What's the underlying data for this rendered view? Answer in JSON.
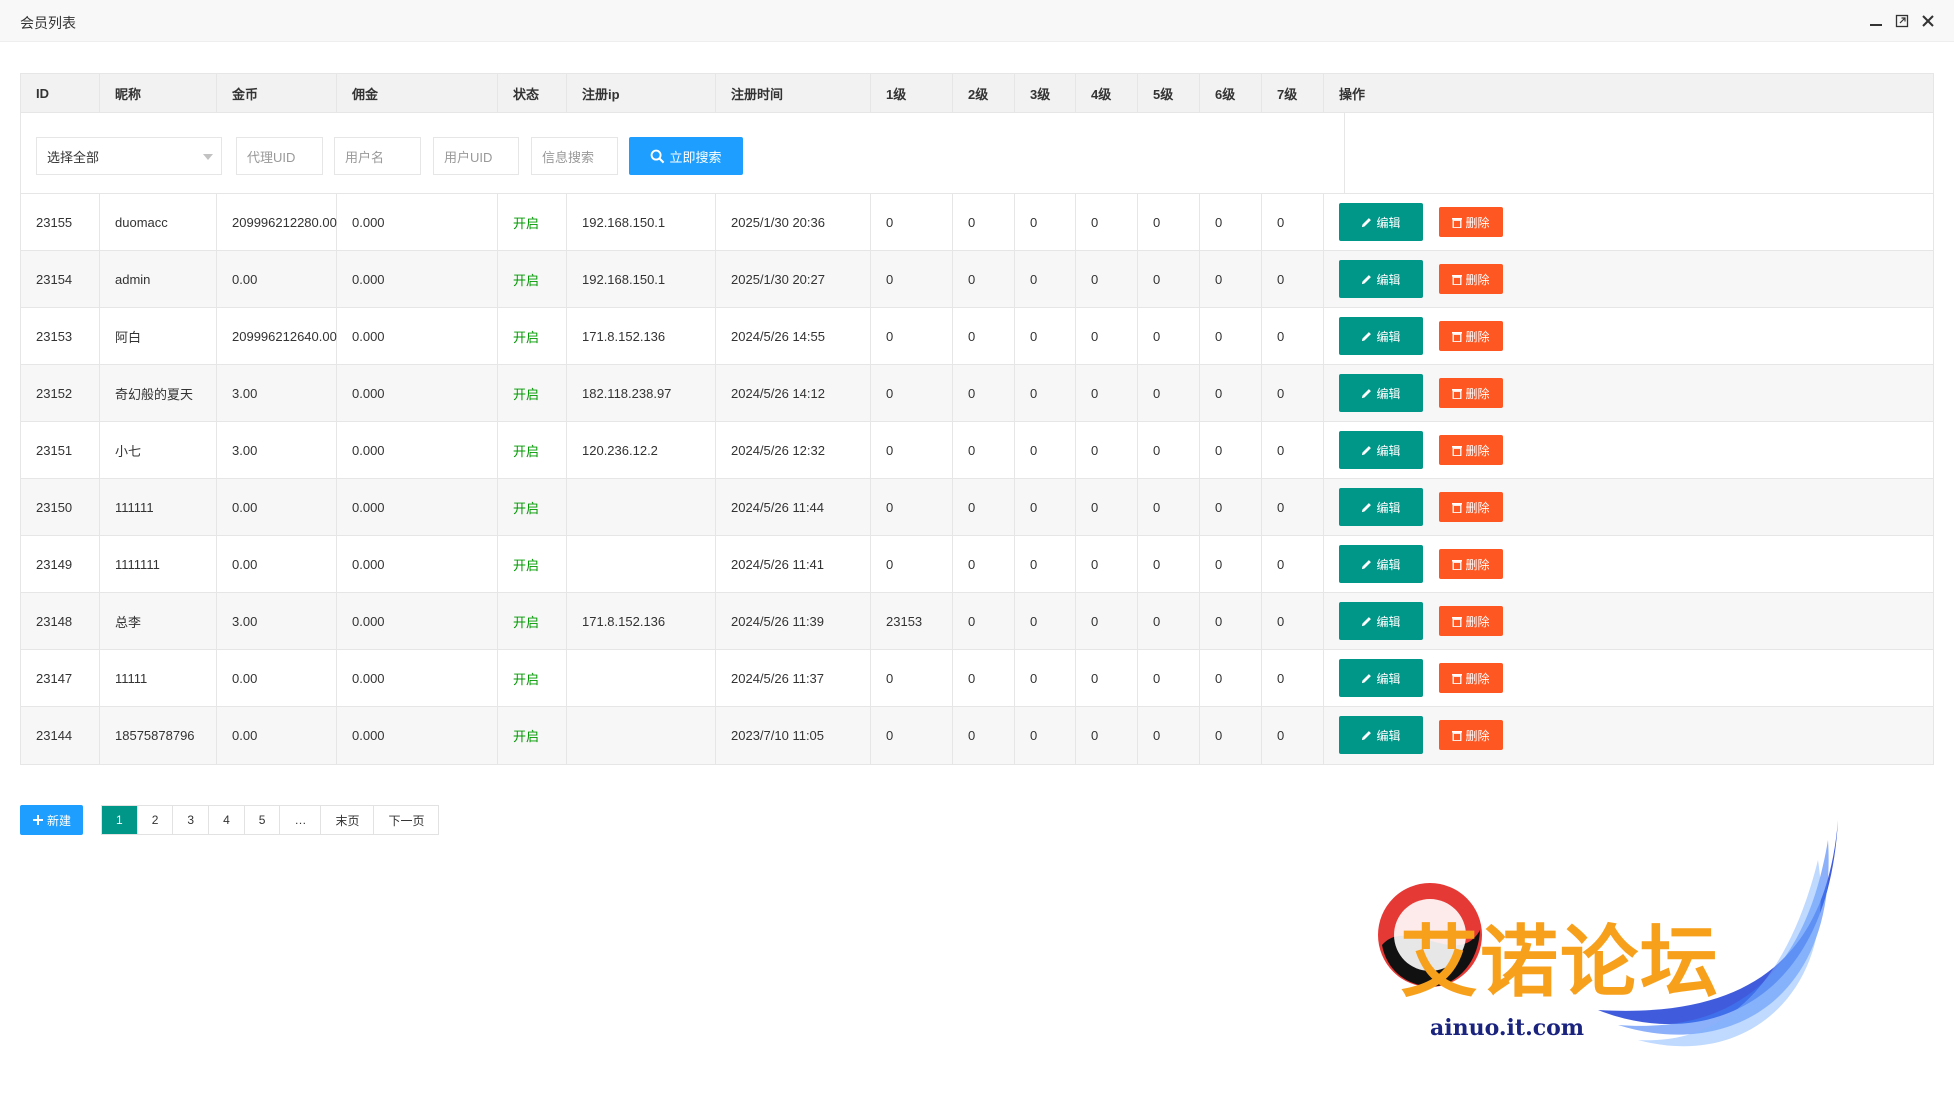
{
  "window": {
    "title": "会员列表"
  },
  "columns": [
    "ID",
    "昵称",
    "金币",
    "佣金",
    "状态",
    "注册ip",
    "注册时间",
    "1级",
    "2级",
    "3级",
    "4级",
    "5级",
    "6级",
    "7级",
    "操作"
  ],
  "filters": {
    "select_value": "选择全部",
    "agent_uid_placeholder": "代理UID",
    "username_placeholder": "用户名",
    "user_uid_placeholder": "用户UID",
    "info_search_placeholder": "信息搜索",
    "search_button": "立即搜索"
  },
  "rows": [
    {
      "id": "23155",
      "nickname": "duomacc",
      "coins": "209996212280.00",
      "commission": "0.000",
      "status": "开启",
      "reg_ip": "192.168.150.1",
      "reg_time": "2025/1/30 20:36",
      "l1": "0",
      "l2": "0",
      "l3": "0",
      "l4": "0",
      "l5": "0",
      "l6": "0",
      "l7": "0"
    },
    {
      "id": "23154",
      "nickname": "admin",
      "coins": "0.00",
      "commission": "0.000",
      "status": "开启",
      "reg_ip": "192.168.150.1",
      "reg_time": "2025/1/30 20:27",
      "l1": "0",
      "l2": "0",
      "l3": "0",
      "l4": "0",
      "l5": "0",
      "l6": "0",
      "l7": "0"
    },
    {
      "id": "23153",
      "nickname": "阿白",
      "coins": "209996212640.00",
      "commission": "0.000",
      "status": "开启",
      "reg_ip": "171.8.152.136",
      "reg_time": "2024/5/26 14:55",
      "l1": "0",
      "l2": "0",
      "l3": "0",
      "l4": "0",
      "l5": "0",
      "l6": "0",
      "l7": "0"
    },
    {
      "id": "23152",
      "nickname": "奇幻般的夏天",
      "coins": "3.00",
      "commission": "0.000",
      "status": "开启",
      "reg_ip": "182.118.238.97",
      "reg_time": "2024/5/26 14:12",
      "l1": "0",
      "l2": "0",
      "l3": "0",
      "l4": "0",
      "l5": "0",
      "l6": "0",
      "l7": "0"
    },
    {
      "id": "23151",
      "nickname": "小七",
      "coins": "3.00",
      "commission": "0.000",
      "status": "开启",
      "reg_ip": "120.236.12.2",
      "reg_time": "2024/5/26 12:32",
      "l1": "0",
      "l2": "0",
      "l3": "0",
      "l4": "0",
      "l5": "0",
      "l6": "0",
      "l7": "0"
    },
    {
      "id": "23150",
      "nickname": "111111",
      "coins": "0.00",
      "commission": "0.000",
      "status": "开启",
      "reg_ip": "",
      "reg_time": "2024/5/26 11:44",
      "l1": "0",
      "l2": "0",
      "l3": "0",
      "l4": "0",
      "l5": "0",
      "l6": "0",
      "l7": "0"
    },
    {
      "id": "23149",
      "nickname": "1111111",
      "coins": "0.00",
      "commission": "0.000",
      "status": "开启",
      "reg_ip": "",
      "reg_time": "2024/5/26 11:41",
      "l1": "0",
      "l2": "0",
      "l3": "0",
      "l4": "0",
      "l5": "0",
      "l6": "0",
      "l7": "0"
    },
    {
      "id": "23148",
      "nickname": "总李",
      "coins": "3.00",
      "commission": "0.000",
      "status": "开启",
      "reg_ip": "171.8.152.136",
      "reg_time": "2024/5/26 11:39",
      "l1": "23153",
      "l2": "0",
      "l3": "0",
      "l4": "0",
      "l5": "0",
      "l6": "0",
      "l7": "0"
    },
    {
      "id": "23147",
      "nickname": "11111",
      "coins": "0.00",
      "commission": "0.000",
      "status": "开启",
      "reg_ip": "",
      "reg_time": "2024/5/26 11:37",
      "l1": "0",
      "l2": "0",
      "l3": "0",
      "l4": "0",
      "l5": "0",
      "l6": "0",
      "l7": "0"
    },
    {
      "id": "23144",
      "nickname": "18575878796",
      "coins": "0.00",
      "commission": "0.000",
      "status": "开启",
      "reg_ip": "",
      "reg_time": "2023/7/10 11:05",
      "l1": "0",
      "l2": "0",
      "l3": "0",
      "l4": "0",
      "l5": "0",
      "l6": "0",
      "l7": "0"
    }
  ],
  "actions": {
    "edit": "编辑",
    "delete": "删除"
  },
  "footer": {
    "new_button": "新建",
    "pages": [
      "1",
      "2",
      "3",
      "4",
      "5",
      "…",
      "末页",
      "下一页"
    ],
    "current_page": "1"
  },
  "watermark": {
    "text": "艾诺论坛",
    "domain": "ainuo.it.com"
  },
  "colors": {
    "primary": "#1e9fff",
    "edit": "#009688",
    "delete": "#ff5722",
    "status_on": "#009900",
    "watermark": "#f7a01c"
  },
  "icons": {
    "minimize": "minimize-icon",
    "maximize": "maximize-icon",
    "close": "close-icon",
    "search": "search-icon",
    "edit": "pencil-icon",
    "delete": "trash-icon",
    "add": "plus-icon"
  }
}
